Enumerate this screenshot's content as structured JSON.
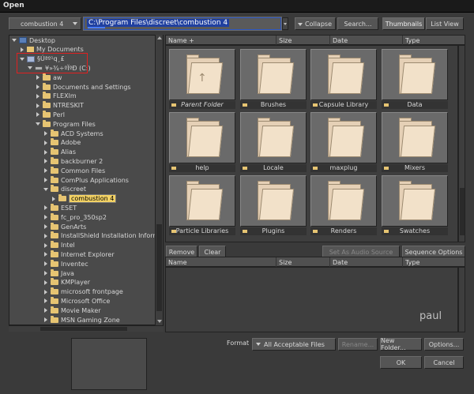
{
  "window": {
    "title": "Open"
  },
  "toolbar": {
    "location_select": "combustion 4",
    "path": "C:\\Program Files\\discreet\\combustion 4",
    "collapse_label": "Collapse",
    "search_label": "Search...",
    "thumbnails_label": "Thumbnails",
    "list_view_label": "List View"
  },
  "tree": {
    "items": [
      {
        "label": "Desktop",
        "indent": 0,
        "expander": "down",
        "icon": "desktop-icon"
      },
      {
        "label": "My Documents",
        "indent": 1,
        "expander": "right",
        "icon": "documents-icon"
      },
      {
        "label": "§Úªº¹q¸£",
        "indent": 1,
        "expander": "down",
        "icon": "computer-icon"
      },
      {
        "label": "¥»¾÷ºÏºÐ (C:)",
        "indent": 2,
        "expander": "down",
        "icon": "drive-icon"
      },
      {
        "label": "aw",
        "indent": 3,
        "expander": "right",
        "icon": "folder-icon"
      },
      {
        "label": "Documents and Settings",
        "indent": 3,
        "expander": "right",
        "icon": "folder-icon"
      },
      {
        "label": "FLEXlm",
        "indent": 3,
        "expander": "right",
        "icon": "folder-icon"
      },
      {
        "label": "NTRESKIT",
        "indent": 3,
        "expander": "right",
        "icon": "folder-icon"
      },
      {
        "label": "Perl",
        "indent": 3,
        "expander": "right",
        "icon": "folder-icon"
      },
      {
        "label": "Program Files",
        "indent": 3,
        "expander": "down",
        "icon": "folder-icon"
      },
      {
        "label": "ACD Systems",
        "indent": 4,
        "expander": "right",
        "icon": "folder-icon"
      },
      {
        "label": "Adobe",
        "indent": 4,
        "expander": "right",
        "icon": "folder-icon"
      },
      {
        "label": "Alias",
        "indent": 4,
        "expander": "right",
        "icon": "folder-icon"
      },
      {
        "label": "backburner 2",
        "indent": 4,
        "expander": "right",
        "icon": "folder-icon"
      },
      {
        "label": "Common Files",
        "indent": 4,
        "expander": "right",
        "icon": "folder-icon"
      },
      {
        "label": "ComPlus Applications",
        "indent": 4,
        "expander": "right",
        "icon": "folder-icon"
      },
      {
        "label": "discreet",
        "indent": 4,
        "expander": "down",
        "icon": "folder-icon"
      },
      {
        "label": "combustion 4",
        "indent": 5,
        "expander": "right",
        "icon": "folder-icon",
        "selected": true
      },
      {
        "label": "ESET",
        "indent": 4,
        "expander": "right",
        "icon": "folder-icon"
      },
      {
        "label": "fc_pro_350sp2",
        "indent": 4,
        "expander": "right",
        "icon": "folder-icon"
      },
      {
        "label": "GenArts",
        "indent": 4,
        "expander": "right",
        "icon": "folder-icon"
      },
      {
        "label": "InstallShield Installation Informa",
        "indent": 4,
        "expander": "right",
        "icon": "folder-icon"
      },
      {
        "label": "Intel",
        "indent": 4,
        "expander": "right",
        "icon": "folder-icon"
      },
      {
        "label": "Internet Explorer",
        "indent": 4,
        "expander": "right",
        "icon": "folder-icon"
      },
      {
        "label": "Inventec",
        "indent": 4,
        "expander": "right",
        "icon": "folder-icon"
      },
      {
        "label": "Java",
        "indent": 4,
        "expander": "right",
        "icon": "folder-icon"
      },
      {
        "label": "KMPlayer",
        "indent": 4,
        "expander": "right",
        "icon": "folder-icon"
      },
      {
        "label": "microsoft frontpage",
        "indent": 4,
        "expander": "right",
        "icon": "folder-icon"
      },
      {
        "label": "Microsoft Office",
        "indent": 4,
        "expander": "right",
        "icon": "folder-icon"
      },
      {
        "label": "Movie Maker",
        "indent": 4,
        "expander": "right",
        "icon": "folder-icon"
      },
      {
        "label": "MSN Gaming Zone",
        "indent": 4,
        "expander": "right",
        "icon": "folder-icon"
      }
    ]
  },
  "file_headers": {
    "name": "Name +",
    "size": "Size",
    "date": "Date",
    "type": "Type"
  },
  "files": [
    {
      "label": "Parent Folder",
      "parent": true
    },
    {
      "label": "Brushes"
    },
    {
      "label": "Capsule Library"
    },
    {
      "label": "Data"
    },
    {
      "label": "help"
    },
    {
      "label": "Locale"
    },
    {
      "label": "maxplug"
    },
    {
      "label": "Mixers"
    },
    {
      "label": "Particle Libraries"
    },
    {
      "label": "Plugins"
    },
    {
      "label": "Renders"
    },
    {
      "label": "Swatches"
    }
  ],
  "audio": {
    "remove_label": "Remove",
    "clear_label": "Clear",
    "set_audio_label": "Set As Audio Source",
    "sequence_label": "Sequence Options",
    "headers": {
      "name": "Name",
      "size": "Size",
      "date": "Date",
      "type": "Type"
    }
  },
  "watermark": "paul",
  "footer": {
    "format_label": "Format",
    "format_value": "All Acceptable Files",
    "rename_label": "Rename...",
    "new_folder_label": "New Folder...",
    "options_label": "Options...",
    "ok_label": "OK",
    "cancel_label": "Cancel"
  },
  "colors": {
    "background": "#3a3a3a",
    "selection": "#f3d264",
    "highlight_box": "#e02020",
    "path_selection": "#2040a0"
  }
}
